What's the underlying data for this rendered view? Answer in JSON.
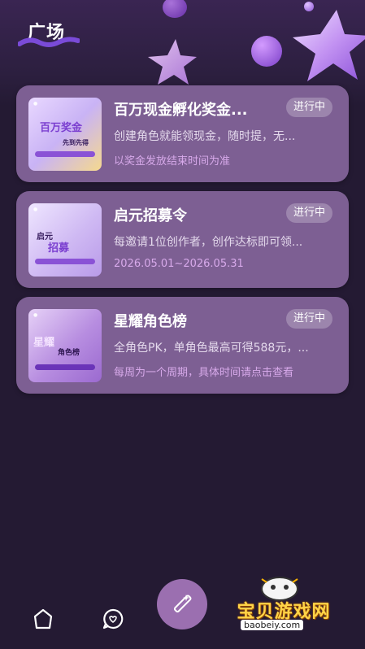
{
  "header": {
    "title": "广场"
  },
  "cards": [
    {
      "title": "百万现金孵化奖金...",
      "status": "进行中",
      "description": "创建角色就能领现金，随时提，无...",
      "time_info": "以奖金发放结束时间为准",
      "thumb_main": "百万奖金",
      "thumb_sub": "先到先得"
    },
    {
      "title": "启元招募令",
      "status": "进行中",
      "description": "每邀请1位创作者，创作达标即可领...",
      "time_info": "2026.05.01~2026.05.31",
      "thumb_main": "招募",
      "thumb_sub": "启元"
    },
    {
      "title": "星耀角色榜",
      "status": "进行中",
      "description": "全角色PK，单角色最高可得588元，...",
      "time_info": "每周为一个周期，具体时间请点击查看",
      "thumb_main": "星耀",
      "thumb_sub": "角色榜"
    }
  ],
  "bottom_nav": {
    "icons": [
      "home-icon",
      "chat-icon",
      "magic-wand-icon"
    ]
  },
  "watermark": {
    "text": "宝贝游戏网",
    "url": "baobeiy.com"
  },
  "colors": {
    "background": "#241a33",
    "card": "#7d5f93",
    "badge": "#9c85ad",
    "time_text": "#d7a9ea",
    "fab": "#9b6fb0"
  }
}
